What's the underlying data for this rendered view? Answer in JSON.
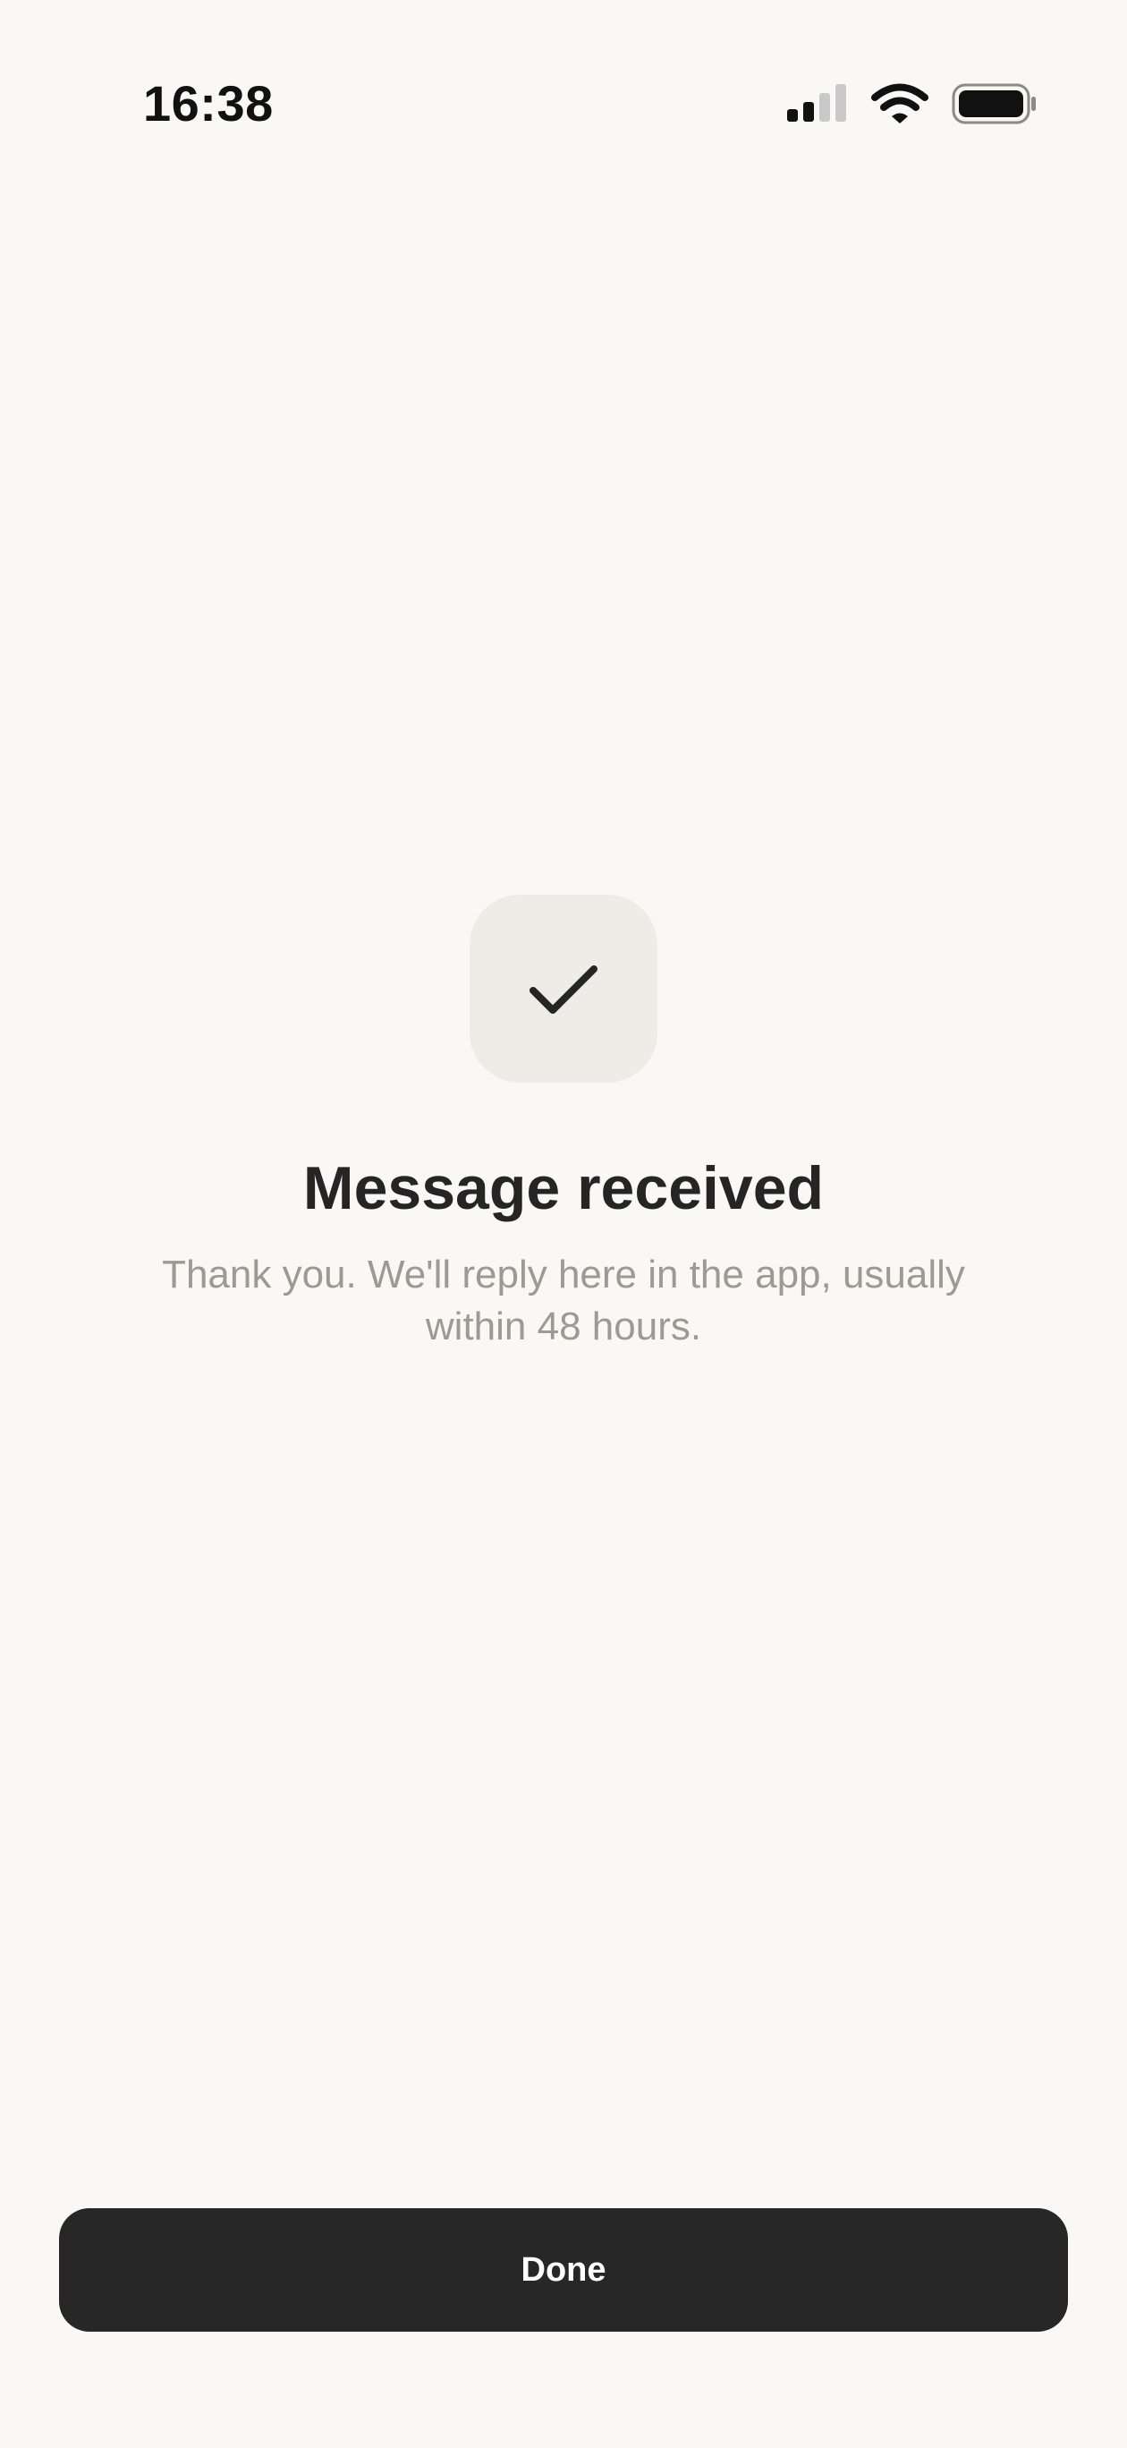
{
  "status_bar": {
    "time": "16:38",
    "icons": [
      "cellular-signal-icon",
      "wifi-icon",
      "battery-icon"
    ]
  },
  "confirmation": {
    "icon": "checkmark-icon",
    "title": "Message received",
    "message": "Thank you. We'll reply here in the app, usually within 48 hours."
  },
  "actions": {
    "done_label": "Done"
  },
  "colors": {
    "background": "#f9f8f4",
    "icon_tile": "#eeece6",
    "title_text": "#252525",
    "body_text": "#9c9a92",
    "button": "#272727",
    "button_text": "#ffffff"
  }
}
